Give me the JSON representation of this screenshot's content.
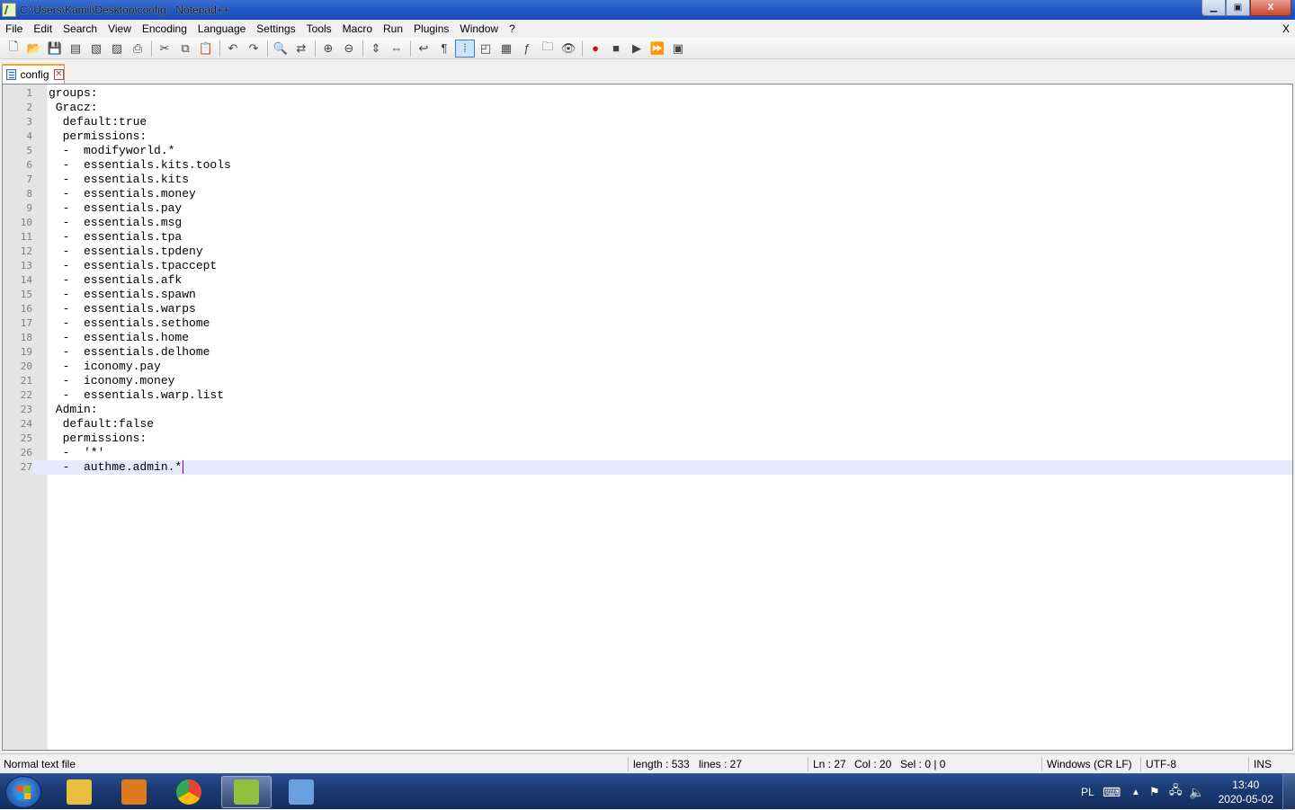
{
  "window": {
    "title": "C:\\Users\\Kamil\\Desktop\\config - Notepad++",
    "minimize_glyph": "▁",
    "maximize_glyph": "▣",
    "close_glyph": "X"
  },
  "menu": {
    "items": [
      "File",
      "Edit",
      "Search",
      "View",
      "Encoding",
      "Language",
      "Settings",
      "Tools",
      "Macro",
      "Run",
      "Plugins",
      "Window",
      "?"
    ],
    "close_label": "X"
  },
  "toolbar": {
    "buttons": [
      {
        "name": "new-file-icon",
        "glyph": "🗋"
      },
      {
        "name": "open-file-icon",
        "glyph": "📂"
      },
      {
        "name": "save-icon",
        "glyph": "💾"
      },
      {
        "name": "save-all-icon",
        "glyph": "▤"
      },
      {
        "name": "close-file-icon",
        "glyph": "▧"
      },
      {
        "name": "close-all-icon",
        "glyph": "▨"
      },
      {
        "name": "print-icon",
        "glyph": "⎙"
      },
      {
        "name": "sep"
      },
      {
        "name": "cut-icon",
        "glyph": "✂"
      },
      {
        "name": "copy-icon",
        "glyph": "⧉"
      },
      {
        "name": "paste-icon",
        "glyph": "📋"
      },
      {
        "name": "sep"
      },
      {
        "name": "undo-icon",
        "glyph": "↶"
      },
      {
        "name": "redo-icon",
        "glyph": "↷"
      },
      {
        "name": "sep"
      },
      {
        "name": "find-icon",
        "glyph": "🔍"
      },
      {
        "name": "replace-icon",
        "glyph": "⇄"
      },
      {
        "name": "sep"
      },
      {
        "name": "zoom-in-icon",
        "glyph": "⊕"
      },
      {
        "name": "zoom-out-icon",
        "glyph": "⊖"
      },
      {
        "name": "sep"
      },
      {
        "name": "sync-vertical-icon",
        "glyph": "⇕"
      },
      {
        "name": "sync-horizontal-icon",
        "glyph": "⇔"
      },
      {
        "name": "sep"
      },
      {
        "name": "word-wrap-icon",
        "glyph": "↩"
      },
      {
        "name": "show-all-chars-icon",
        "glyph": "¶"
      },
      {
        "name": "indent-guide-icon",
        "glyph": "⁞",
        "active": true
      },
      {
        "name": "user-language-icon",
        "glyph": "◰"
      },
      {
        "name": "doc-map-icon",
        "glyph": "▦"
      },
      {
        "name": "function-list-icon",
        "glyph": "ƒ"
      },
      {
        "name": "folder-workspace-icon",
        "glyph": "🗀"
      },
      {
        "name": "monitoring-icon",
        "glyph": "👁"
      },
      {
        "name": "sep"
      },
      {
        "name": "record-macro-icon",
        "glyph": "●",
        "color": "#d01010"
      },
      {
        "name": "stop-record-icon",
        "glyph": "■"
      },
      {
        "name": "playback-macro-icon",
        "glyph": "▶"
      },
      {
        "name": "run-macro-multiple-icon",
        "glyph": "⏩"
      },
      {
        "name": "save-macro-icon",
        "glyph": "▣"
      }
    ]
  },
  "tab": {
    "label": "config",
    "close_glyph": "✕"
  },
  "editor": {
    "current_line": 27,
    "lines": [
      "groups:",
      " Gracz:",
      "  default:true",
      "  permissions:",
      "  -  modifyworld.*",
      "  -  essentials.kits.tools",
      "  -  essentials.kits",
      "  -  essentials.money",
      "  -  essentials.pay",
      "  -  essentials.msg",
      "  -  essentials.tpa",
      "  -  essentials.tpdeny",
      "  -  essentials.tpaccept",
      "  -  essentials.afk",
      "  -  essentials.spawn",
      "  -  essentials.warps",
      "  -  essentials.sethome",
      "  -  essentials.home",
      "  -  essentials.delhome",
      "  -  iconomy.pay",
      "  -  iconomy.money",
      "  -  essentials.warp.list",
      " Admin:",
      "  default:false",
      "  permissions:",
      "  -  '*'",
      "  -  authme.admin.*"
    ]
  },
  "status": {
    "file_type": "Normal text file",
    "length": "length : 533",
    "lines": "lines : 27",
    "ln": "Ln : 27",
    "col": "Col : 20",
    "sel": "Sel : 0 | 0",
    "eol": "Windows (CR LF)",
    "encoding": "UTF-8",
    "mode": "INS"
  },
  "taskbar": {
    "apps": [
      {
        "name": "explorer-icon",
        "color": "#e8c040",
        "active": false
      },
      {
        "name": "media-player-icon",
        "color": "#e07a20",
        "active": false
      },
      {
        "name": "chrome-icon",
        "color": "#34a853",
        "active": false
      },
      {
        "name": "notepadpp-icon",
        "color": "#90c040",
        "active": true
      },
      {
        "name": "paint-icon",
        "color": "#6aa0e0",
        "active": false
      }
    ],
    "language": "PL",
    "time": "13:40",
    "date": "2020-05-02"
  }
}
